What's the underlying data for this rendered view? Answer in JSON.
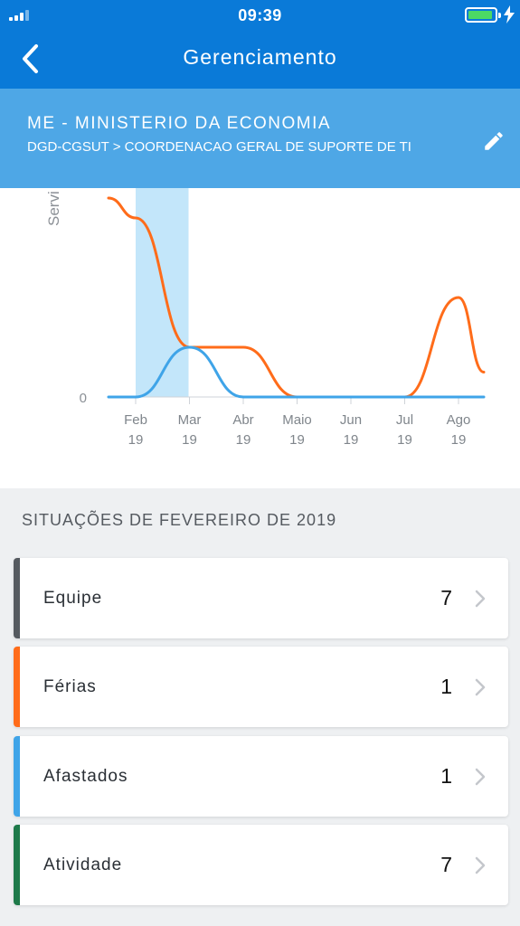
{
  "status_bar": {
    "time": "09:39"
  },
  "nav": {
    "title": "Gerenciamento",
    "back_icon": "chevron-left-icon"
  },
  "org": {
    "name": "ME - MINISTERIO DA ECONOMIA",
    "department": "DGD-CGSUT > COORDENACAO GERAL DE SUPORTE DE TI",
    "edit_icon": "pencil-icon"
  },
  "chart_data": {
    "type": "line",
    "ylabel": "Servi",
    "categories": [
      "Feb 19",
      "Mar 19",
      "Abr 19",
      "Maio 19",
      "Jun 19",
      "Jul 19",
      "Ago 19"
    ],
    "x_labels": [
      {
        "month": "Feb",
        "year": "19"
      },
      {
        "month": "Mar",
        "year": "19"
      },
      {
        "month": "Abr",
        "year": "19"
      },
      {
        "month": "Maio",
        "year": "19"
      },
      {
        "month": "Jun",
        "year": "19"
      },
      {
        "month": "Jul",
        "year": "19"
      },
      {
        "month": "Ago",
        "year": "19"
      }
    ],
    "y_ticks": [
      "0"
    ],
    "selected_category": "Feb 19",
    "series": [
      {
        "color": "#ff6c1a",
        "values": [
          3.6,
          1.0,
          1.0,
          0,
          0,
          0,
          2.0
        ],
        "start_value": 4.0,
        "end_value": 0.5
      },
      {
        "color": "#3fa4e8",
        "values": [
          0,
          1.0,
          0,
          0,
          0,
          0,
          0
        ],
        "start_value": 0,
        "end_value": 0
      }
    ],
    "ylim": [
      0,
      4.2
    ],
    "grid": false
  },
  "situations": {
    "title": "SITUAÇÕES DE FEVEREIRO DE 2019",
    "items": [
      {
        "label": "Equipe",
        "count": "7",
        "color": "#555a60"
      },
      {
        "label": "Férias",
        "count": "1",
        "color": "#ff6c1a"
      },
      {
        "label": "Afastados",
        "count": "1",
        "color": "#3fa4e8"
      },
      {
        "label": "Atividade",
        "count": "7",
        "color": "#1e7a4a"
      }
    ]
  }
}
